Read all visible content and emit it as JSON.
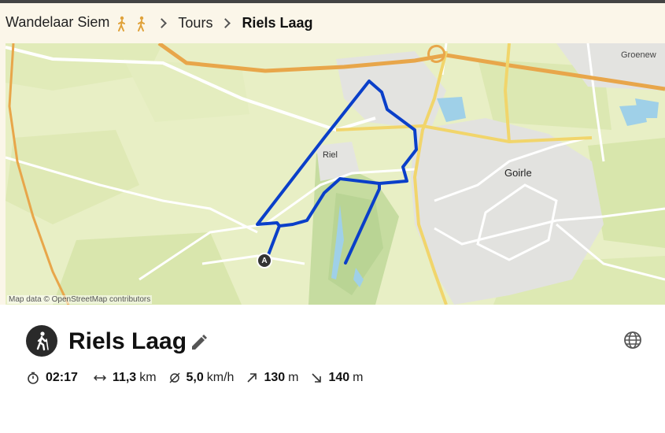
{
  "breadcrumb": {
    "home": "Wandelaar Siem",
    "tours": "Tours",
    "current": "Riels Laag"
  },
  "map": {
    "labels": {
      "riel": "Riel",
      "goirle": "Goirle",
      "groenew": "Groenew"
    },
    "start_marker": "A",
    "attribution": "Map data © OpenStreetMap contributors",
    "route_color": "#0a3fc9"
  },
  "tour": {
    "title": "Riels Laag",
    "activity_icon": "hiking-icon",
    "stats": {
      "duration": "02:17",
      "distance": "11,3",
      "distance_unit": "km",
      "speed": "5,0",
      "speed_unit": "km/h",
      "ascent": "130",
      "ascent_unit": "m",
      "descent": "140",
      "descent_unit": "m"
    }
  }
}
